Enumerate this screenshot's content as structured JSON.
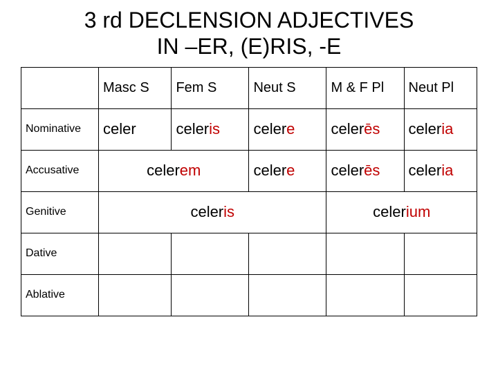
{
  "title_line1": "3 rd DECLENSION ADJECTIVES",
  "title_line2": "IN –ER, (E)RIS, -E",
  "headers": {
    "masc_s": "Masc S",
    "fem_s": "Fem S",
    "neut_s": "Neut S",
    "mf_pl": "M & F Pl",
    "neut_pl": "Neut Pl"
  },
  "rows": {
    "nom": "Nominative",
    "acc": "Accusative",
    "gen": "Genitive",
    "dat": "Dative",
    "abl": "Ablative"
  },
  "stem": "celer",
  "sfx": {
    "is": "is",
    "e": "e",
    "es": "ēs",
    "ia": "ia",
    "em": "em",
    "ium": "ium"
  },
  "chart_data": {
    "type": "table",
    "title": "3rd Declension Adjectives in –ER, (E)RIS, -E",
    "columns": [
      "Masc S",
      "Fem S",
      "Neut S",
      "M & F Pl",
      "Neut Pl"
    ],
    "rows": [
      {
        "case": "Nominative",
        "cells": [
          "celer",
          "celeris",
          "celere",
          "celerēs",
          "celeria"
        ]
      },
      {
        "case": "Accusative",
        "cells": [
          "celerem",
          "celerem",
          "celere",
          "celerēs",
          "celeria"
        ],
        "merges": [
          [
            0,
            1
          ]
        ]
      },
      {
        "case": "Genitive",
        "cells": [
          "celeris",
          "celeris",
          "celeris",
          "celerium",
          "celerium"
        ],
        "merges": [
          [
            0,
            2
          ],
          [
            3,
            4
          ]
        ]
      },
      {
        "case": "Dative",
        "cells": [
          "",
          "",
          "",
          "",
          ""
        ]
      },
      {
        "case": "Ablative",
        "cells": [
          "",
          "",
          "",
          "",
          ""
        ]
      }
    ]
  }
}
